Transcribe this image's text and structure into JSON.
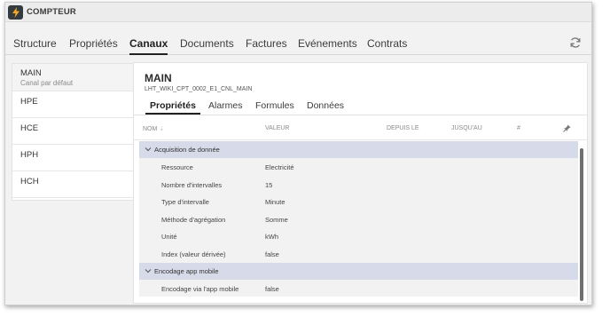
{
  "header": {
    "title": "COMPTEUR",
    "icon": "lightning-icon"
  },
  "main_tabs": [
    {
      "label": "Structure",
      "active": false
    },
    {
      "label": "Propriétés",
      "active": false
    },
    {
      "label": "Canaux",
      "active": true
    },
    {
      "label": "Documents",
      "active": false
    },
    {
      "label": "Factures",
      "active": false
    },
    {
      "label": "Evénements",
      "active": false
    },
    {
      "label": "Contrats",
      "active": false
    }
  ],
  "sidebar": {
    "items": [
      {
        "label": "MAIN",
        "sublabel": "Canal par défaut",
        "selected": true
      },
      {
        "label": "HPE"
      },
      {
        "label": "HCE"
      },
      {
        "label": "HPH"
      },
      {
        "label": "HCH"
      }
    ]
  },
  "panel": {
    "title": "MAIN",
    "subtitle": "LHT_WIKI_CPT_0002_E1_CNL_MAIN",
    "subtabs": [
      {
        "label": "Propriétés",
        "active": true
      },
      {
        "label": "Alarmes",
        "active": false
      },
      {
        "label": "Formules",
        "active": false
      },
      {
        "label": "Données",
        "active": false
      }
    ],
    "columns": {
      "nom": "NOM",
      "valeur": "VALEUR",
      "depuis": "DEPUIS LE",
      "jusqu": "JUSQU'AU",
      "hash": "#"
    },
    "groups": [
      {
        "label": "Acquisition de donnée",
        "rows": [
          {
            "name": "Ressource",
            "value": "Electricité"
          },
          {
            "name": "Nombre d'intervalles",
            "value": "15"
          },
          {
            "name": "Type d'intervalle",
            "value": "Minute"
          },
          {
            "name": "Méthode d'agrégation",
            "value": "Somme"
          },
          {
            "name": "Unité",
            "value": "kWh"
          },
          {
            "name": "Index (valeur dérivée)",
            "value": "false"
          }
        ]
      },
      {
        "label": "Encodage app mobile",
        "rows": [
          {
            "name": "Encodage via l'app mobile",
            "value": "false"
          }
        ]
      }
    ]
  },
  "colors": {
    "group_header_bg": "#d7dae8",
    "row_bg": "#f2f2f2",
    "app_icon_bg": "#333a40",
    "app_icon_fg": "#f5a623"
  }
}
